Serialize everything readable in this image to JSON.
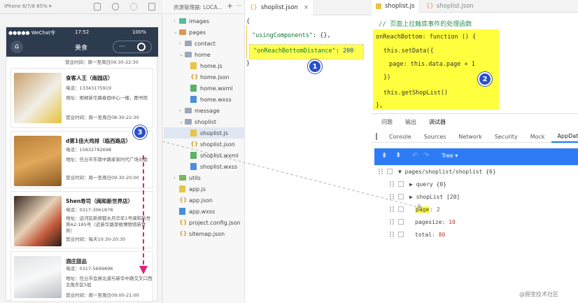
{
  "simulator": {
    "device": "iPhone 6/7/8 85% ▾",
    "carrier": "●●●●● WeChat令",
    "time": "17:52",
    "battery": "100%",
    "title": "美食",
    "cards": [
      {
        "addr_partial": "营业时间：周一至周日09:30-22:30"
      },
      {
        "name": "食客人王（南园店）",
        "phone": "电话：13343175919",
        "addr": "地址：邯郸新华路春园中心一楼，图书馆",
        "hours": "营业时间：周一至周日08:30-22:30"
      },
      {
        "name": "d第1佳大鸡排（临西路店）",
        "phone": "电话：15832782698",
        "addr": "地址：任丘市东南中路家家时代广场对面",
        "hours": "营业时间：周一至周日09:30-20:00"
      },
      {
        "name": "Shen寿司（闽和新世界店）",
        "phone": "电话：0317-3061878",
        "addr": "地址：运河区新郑都水月华年1号闽和新世界A2-185号（近新华路菜根博物馆新世界）",
        "hours": "营业时间：每天10:30-20:30"
      },
      {
        "name": "酒庄甜品",
        "phone": "电话：0317-5699896",
        "addr": "地址：任丘市会展北道与新华中路交叉口西北角东区5层",
        "hours": "营业时间：周一至周日09:00-21:00"
      }
    ]
  },
  "explorer": {
    "header": "资源管理器: LOCA...",
    "add": "+",
    "more": "···",
    "items": [
      "images",
      "pages",
      "contact",
      "home",
      "home.js",
      "home.json",
      "home.wxml",
      "home.wxss",
      "message",
      "shoplist",
      "shoplist.js",
      "shoplist.json",
      "shoplist.wxml",
      "shoplist.wxss",
      "utils",
      "app.js",
      "app.json",
      "app.wxss",
      "project.config.json",
      "sitemap.json"
    ]
  },
  "editor": {
    "tab": "shoplist.json",
    "close": "×",
    "brace_open": "{",
    "brace_close": "}",
    "line1_key": "\"usingComponents\"",
    "line1_rest": ": {},",
    "line2_key": "\"onReachBottomDistance\"",
    "line2_colon": ": ",
    "line2_val": "200"
  },
  "right": {
    "tab1": "shoplist.js",
    "tab2": "shoplist.json",
    "comment": "// 页面上拉触底事件的处理函数",
    "code": [
      "onReachBottom: function () {",
      "this.setData({",
      "page: this.data.page + 1",
      "})",
      "this.getShopList()",
      "},"
    ]
  },
  "devtools": {
    "toptabs": [
      "问题",
      "输出",
      "调试器"
    ],
    "tabs": [
      "Console",
      "Sources",
      "Network",
      "Security",
      "Mock",
      "AppData"
    ],
    "tree_label": "Tree ▾",
    "rows": [
      {
        "text": "▼ pages/shoplist/shoplist {6}"
      },
      {
        "text": "▶ query {0}"
      },
      {
        "text": "▶ shopList [20]"
      },
      {
        "key": "page",
        "val": ": 2"
      },
      {
        "key": "pagesize",
        "val": ": 10"
      },
      {
        "key": "total",
        "val": ": 80"
      }
    ]
  },
  "badges": [
    "1",
    "2",
    "3"
  ],
  "watermark": "@掘金技术社区"
}
